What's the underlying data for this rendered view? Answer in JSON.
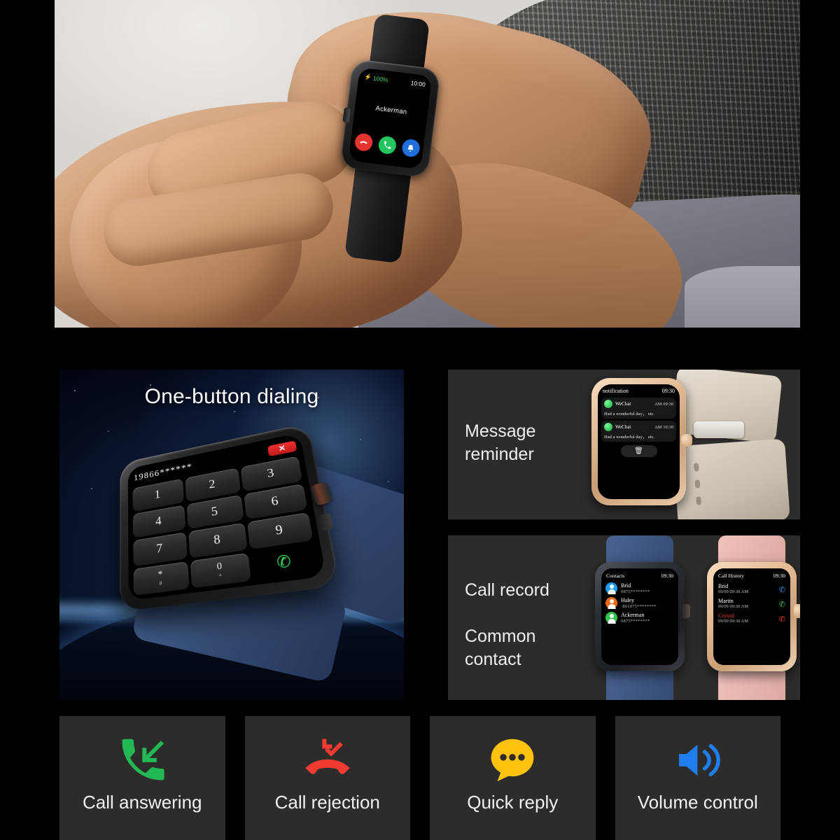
{
  "hero": {
    "watch": {
      "battery": "100%",
      "time": "10:00",
      "caller_name": "Ackerman",
      "buttons": [
        {
          "name": "decline-call",
          "glyph": "⌕",
          "color": "#e5342f"
        },
        {
          "name": "accept-call",
          "glyph": "✆",
          "color": "#22c55e"
        },
        {
          "name": "silence-ring",
          "glyph": "␇",
          "color": "#1f6fe0"
        }
      ]
    }
  },
  "dialing": {
    "title": "One-button dialing",
    "number": "19866******",
    "delete_label": "✕",
    "keys": [
      {
        "main": "1",
        "sub": ""
      },
      {
        "main": "2",
        "sub": ""
      },
      {
        "main": "3",
        "sub": ""
      },
      {
        "main": "4",
        "sub": ""
      },
      {
        "main": "5",
        "sub": ""
      },
      {
        "main": "6",
        "sub": ""
      },
      {
        "main": "7",
        "sub": ""
      },
      {
        "main": "8",
        "sub": ""
      },
      {
        "main": "9",
        "sub": ""
      },
      {
        "main": "*",
        "sub": "#"
      },
      {
        "main": "0",
        "sub": "+"
      },
      {
        "main": "✆",
        "sub": ""
      }
    ]
  },
  "message_reminder": {
    "label_line1": "Message",
    "label_line2": "reminder",
    "screen": {
      "title": "notification",
      "time": "09:30",
      "messages": [
        {
          "app": "WeChat",
          "time": "AM 09:30",
          "text": "Had a wonderful day， etc."
        },
        {
          "app": "WeChat",
          "time": "AM 10:30",
          "text": "Had a wonderful day， etc."
        }
      ],
      "delete_icon": "🗑"
    }
  },
  "call_record": {
    "label_call": "Call record",
    "label_common_line1": "Common",
    "label_common_line2": "contact",
    "contacts_screen": {
      "title": "Contacts",
      "time": "09:30",
      "rows": [
        {
          "name": "Brid",
          "number": "0875********",
          "avatar_color": "#1a9ff0"
        },
        {
          "name": "Haley",
          "number": "·861875********",
          "avatar_color": "#f26a1b"
        },
        {
          "name": "Ackerman",
          "number": "0875********",
          "avatar_color": "#2fc44a"
        }
      ]
    },
    "history_screen": {
      "title": "Call History",
      "time": "09:30",
      "rows": [
        {
          "name": "Brid",
          "date": "09/09",
          "time": "09:30 AM",
          "icon": "✆",
          "color": "#ffffff",
          "icon_color": "#2e8fe8"
        },
        {
          "name": "Martin",
          "date": "09/09",
          "time": "09:30 AM",
          "icon": "✆",
          "color": "#ffffff",
          "icon_color": "#2fc44a"
        },
        {
          "name": "Crystal",
          "date": "09/09",
          "time": "09:30 AM",
          "icon": "✆",
          "color": "#e8352c",
          "icon_color": "#e8352c"
        }
      ]
    }
  },
  "features": [
    {
      "label": "Call answering",
      "icon": "phone-incoming-icon",
      "color": "#22b855"
    },
    {
      "label": "Call rejection",
      "icon": "phone-missed-icon",
      "color": "#ef3b32"
    },
    {
      "label": "Quick reply",
      "icon": "chat-bubble-icon",
      "color": "#ffc20e"
    },
    {
      "label": "Volume control",
      "icon": "speaker-icon",
      "color": "#1f7ef0"
    }
  ]
}
